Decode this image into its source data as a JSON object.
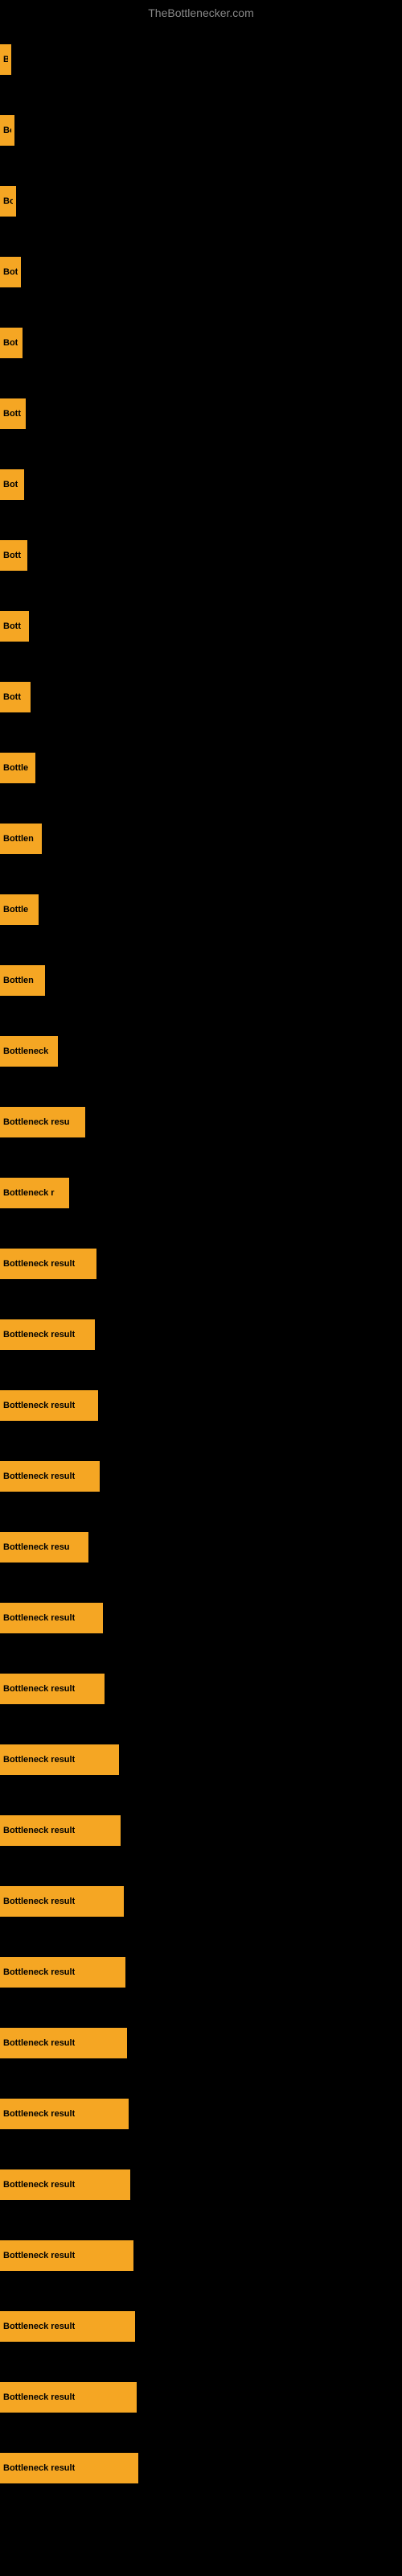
{
  "site_title": "TheBottlenecker.com",
  "bars": [
    {
      "label": "B",
      "width": 14
    },
    {
      "label": "Bo",
      "width": 18
    },
    {
      "label": "Bo",
      "width": 20
    },
    {
      "label": "Bot",
      "width": 26
    },
    {
      "label": "Bot",
      "width": 28
    },
    {
      "label": "Bott",
      "width": 32
    },
    {
      "label": "Bot",
      "width": 30
    },
    {
      "label": "Bott",
      "width": 34
    },
    {
      "label": "Bott",
      "width": 36
    },
    {
      "label": "Bott",
      "width": 38
    },
    {
      "label": "Bottle",
      "width": 44
    },
    {
      "label": "Bottlen",
      "width": 52
    },
    {
      "label": "Bottle",
      "width": 48
    },
    {
      "label": "Bottlen",
      "width": 56
    },
    {
      "label": "Bottleneck",
      "width": 72
    },
    {
      "label": "Bottleneck resu",
      "width": 106
    },
    {
      "label": "Bottleneck r",
      "width": 86
    },
    {
      "label": "Bottleneck result",
      "width": 120
    },
    {
      "label": "Bottleneck result",
      "width": 118
    },
    {
      "label": "Bottleneck result",
      "width": 122
    },
    {
      "label": "Bottleneck result",
      "width": 124
    },
    {
      "label": "Bottleneck resu",
      "width": 110
    },
    {
      "label": "Bottleneck result",
      "width": 128
    },
    {
      "label": "Bottleneck result",
      "width": 130
    },
    {
      "label": "Bottleneck result",
      "width": 148
    },
    {
      "label": "Bottleneck result",
      "width": 150
    },
    {
      "label": "Bottleneck result",
      "width": 154
    },
    {
      "label": "Bottleneck result",
      "width": 156
    },
    {
      "label": "Bottleneck result",
      "width": 158
    },
    {
      "label": "Bottleneck result",
      "width": 160
    },
    {
      "label": "Bottleneck result",
      "width": 162
    },
    {
      "label": "Bottleneck result",
      "width": 166
    },
    {
      "label": "Bottleneck result",
      "width": 168
    },
    {
      "label": "Bottleneck result",
      "width": 170
    },
    {
      "label": "Bottleneck result",
      "width": 172
    }
  ]
}
